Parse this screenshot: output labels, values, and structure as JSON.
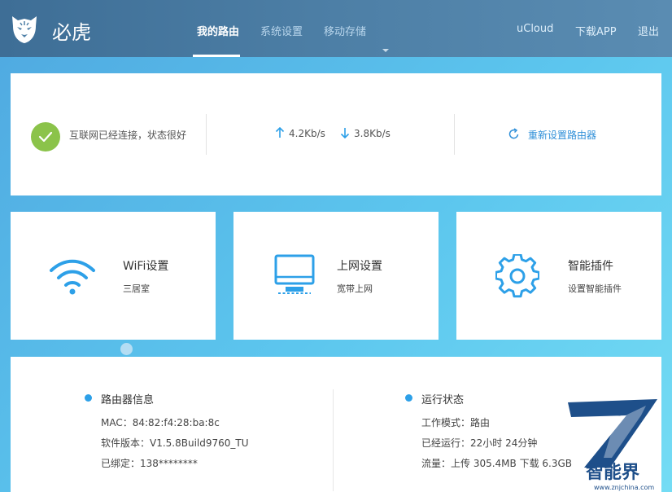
{
  "header": {
    "brand": "必虎",
    "nav": [
      {
        "label": "我的路由",
        "active": true
      },
      {
        "label": "系统设置",
        "active": false
      },
      {
        "label": "移动存储",
        "active": false
      }
    ],
    "links": [
      "uCloud",
      "下载APP",
      "退出"
    ]
  },
  "status": {
    "connection": "互联网已经连接，状态很好",
    "upload_speed": "4.2Kb/s",
    "download_speed": "3.8Kb/s",
    "reset_label": "重新设置路由器"
  },
  "tiles": [
    {
      "icon": "wifi-icon",
      "title": "WiFi设置",
      "subtitle": "三居室"
    },
    {
      "icon": "monitor-icon",
      "title": "上网设置",
      "subtitle": "宽带上网"
    },
    {
      "icon": "gear-icon",
      "title": "智能插件",
      "subtitle": "设置智能插件"
    }
  ],
  "router_info": {
    "title": "路由器信息",
    "mac": "MAC：84:82:f4:28:ba:8c",
    "firmware": "软件版本：V1.5.8Build9760_TU",
    "bound": "已绑定：138********"
  },
  "run_status": {
    "title": "运行状态",
    "mode": "工作模式：路由",
    "uptime": "已经运行：22小时 24分钟",
    "traffic": "流量：上传 305.4MB 下载 6.3GB"
  },
  "watermark": {
    "text": "智能界",
    "url": "www.znjchina.com"
  },
  "colors": {
    "accent": "#2f8fd8",
    "success": "#8bc34a",
    "topbar": "#4d7fa6"
  }
}
